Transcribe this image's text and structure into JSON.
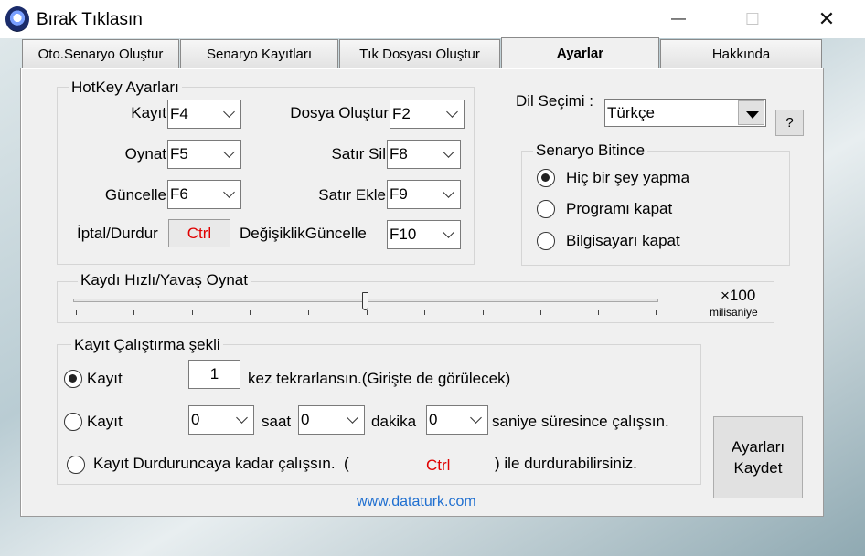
{
  "window": {
    "title": "Bırak Tıklasın",
    "minimize": "—",
    "maximize": "☐",
    "close": "✕"
  },
  "tabs": [
    "Oto.Senaryo Oluştur",
    "Senaryo Kayıtları",
    "Tık Dosyası Oluştur",
    "Ayarlar",
    "Hakkında"
  ],
  "active_tab": "Ayarlar",
  "hotkeys": {
    "title": "HotKey Ayarları",
    "kayit": {
      "label": "Kayıt",
      "value": "F4"
    },
    "oynat": {
      "label": "Oynat",
      "value": "F5"
    },
    "guncelle": {
      "label": "Güncelle",
      "value": "F6"
    },
    "iptal": {
      "label": "İptal/Durdur",
      "value": "Ctrl"
    },
    "dosya": {
      "label": "Dosya Oluştur",
      "value": "F2"
    },
    "satirsil": {
      "label": "Satır Sil",
      "value": "F8"
    },
    "satirekle": {
      "label": "Satır Ekle",
      "value": "F9"
    },
    "degisiklik": {
      "label": "DeğişiklikGüncelle",
      "value": "F10"
    }
  },
  "language": {
    "label": "Dil Seçimi :",
    "value": "Türkçe",
    "help": "?"
  },
  "scenario_end": {
    "title": "Senaryo Bitince",
    "options": [
      "Hiç bir şey yapma",
      "Programı kapat",
      "Bilgisayarı kapat"
    ],
    "selected": 0
  },
  "speed": {
    "title": "Kaydı Hızlı/Yavaş Oynat",
    "multiplier": "×100",
    "unit": "milisaniye",
    "slider_fraction": 0.5
  },
  "run_mode": {
    "title": "Kayıt Çalıştırma şekli",
    "opt1_label": "Kayıt",
    "repeat_count": "1",
    "opt1_suffix": "kez tekrarlansın.(Girişte de görülecek)",
    "opt2_label": "Kayıt",
    "hours": "0",
    "hours_label": "saat",
    "minutes": "0",
    "minutes_label": "dakika",
    "seconds": "0",
    "seconds_label": "saniye süresince çalışsın.",
    "opt3_label": "Kayıt Durduruncaya kadar çalışsın.  (",
    "opt3_key": "Ctrl",
    "opt3_suffix": ") ile durdurabilirsiniz.",
    "selected": 0
  },
  "save_button": {
    "line1": "Ayarları",
    "line2": "Kaydet"
  },
  "footer_link": "www.dataturk.com"
}
